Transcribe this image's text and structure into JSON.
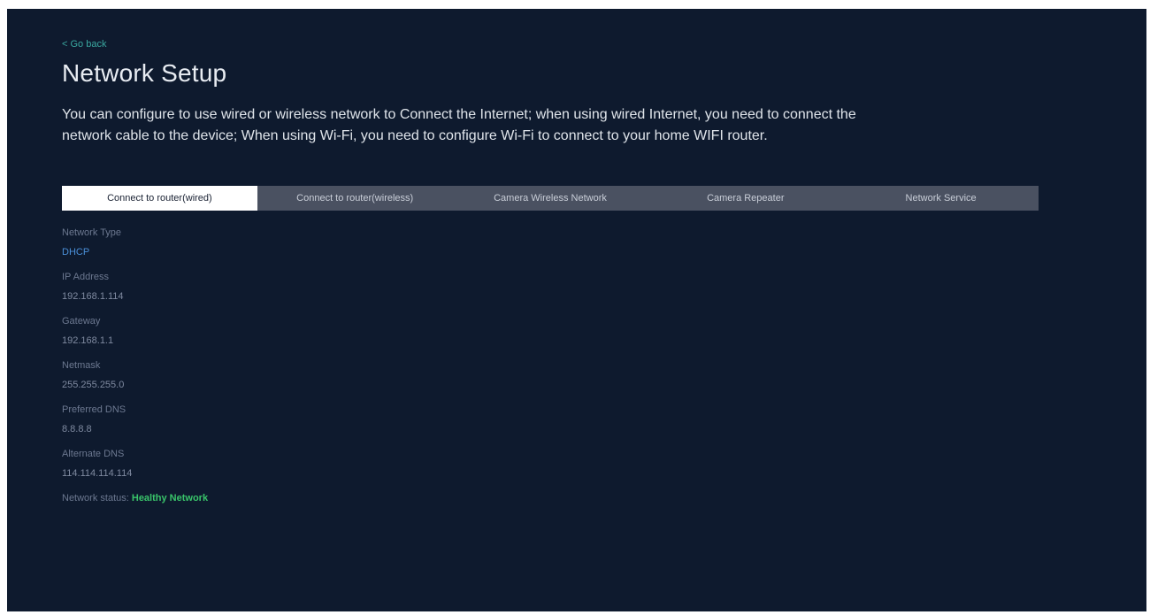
{
  "nav": {
    "back_label": "< Go back"
  },
  "page": {
    "title": "Network Setup",
    "description": "You can configure to use wired or wireless network to Connect the Internet; when using wired Internet, you need to connect the network cable to the device; When using Wi-Fi, you need to configure Wi-Fi to connect to your home WIFI router."
  },
  "tabs": [
    {
      "label": "Connect to router(wired)",
      "active": true
    },
    {
      "label": "Connect to router(wireless)",
      "active": false
    },
    {
      "label": "Camera Wireless Network",
      "active": false
    },
    {
      "label": "Camera Repeater",
      "active": false
    },
    {
      "label": "Network Service",
      "active": false
    }
  ],
  "fields": {
    "network_type": {
      "label": "Network Type",
      "value": "DHCP"
    },
    "ip_address": {
      "label": "IP Address",
      "value": "192.168.1.114"
    },
    "gateway": {
      "label": "Gateway",
      "value": "192.168.1.1"
    },
    "netmask": {
      "label": "Netmask",
      "value": "255.255.255.0"
    },
    "preferred_dns": {
      "label": "Preferred DNS",
      "value": "8.8.8.8"
    },
    "alternate_dns": {
      "label": "Alternate DNS",
      "value": "114.114.114.114"
    }
  },
  "status": {
    "label": "Network status:",
    "value": "Healthy Network"
  },
  "colors": {
    "background": "#0e1a2e",
    "accent_link": "#3aa8a0",
    "value_accent": "#4a8fd8",
    "status_ok": "#39c46a",
    "tab_bar": "#4a5161",
    "tab_active": "#ffffff"
  }
}
